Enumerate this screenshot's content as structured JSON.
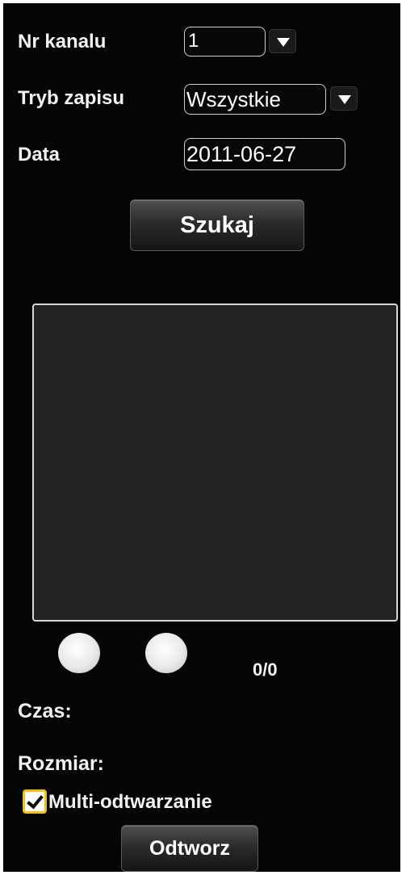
{
  "form": {
    "channel_label": "Nr kanalu",
    "channel_value": "1",
    "record_mode_label": "Tryb zapisu",
    "record_mode_value": "Wszystkie",
    "date_label": "Data",
    "date_value": "2011-06-27",
    "search_button": "Szukaj"
  },
  "results": {
    "items": [],
    "page_counter": "0/0"
  },
  "info": {
    "time_label": "Czas:",
    "size_label": "Rozmiar:"
  },
  "options": {
    "multi_playback_label": "Multi-odtwarzanie",
    "multi_playback_checked": true
  },
  "actions": {
    "play_button": "Odtworz"
  }
}
